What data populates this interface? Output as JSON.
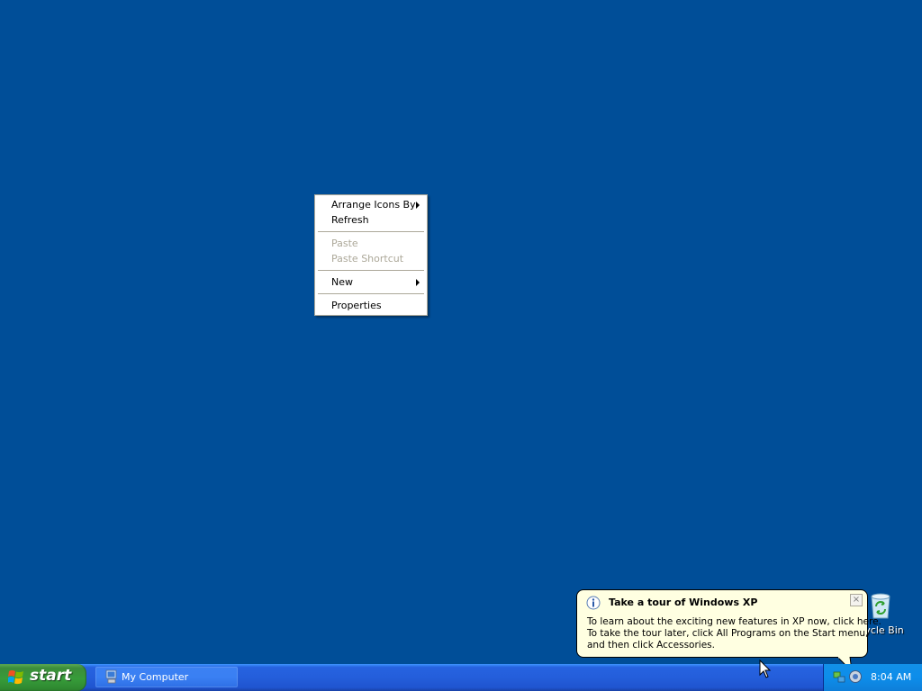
{
  "context_menu": {
    "items": [
      {
        "label": "Arrange Icons By",
        "enabled": true,
        "submenu": true
      },
      {
        "label": "Refresh",
        "enabled": true,
        "submenu": false
      },
      {
        "label": "Paste",
        "enabled": false,
        "submenu": false
      },
      {
        "label": "Paste Shortcut",
        "enabled": false,
        "submenu": false
      },
      {
        "label": "New",
        "enabled": true,
        "submenu": true
      },
      {
        "label": "Properties",
        "enabled": true,
        "submenu": false
      }
    ]
  },
  "desktop": {
    "background_color": "#004E98",
    "icons": [
      {
        "label": "ycle Bin",
        "icon": "recycle-bin-icon"
      }
    ]
  },
  "balloon": {
    "icon": "info-icon",
    "title": "Take a tour of Windows XP",
    "lines": [
      "To learn about the exciting new features in XP now, click here.",
      "To take the tour later, click All Programs on the Start menu,",
      "and then click Accessories."
    ],
    "close_label": "×"
  },
  "taskbar": {
    "start_label": "start",
    "tasks": [
      {
        "label": "My Computer",
        "icon": "my-computer-icon"
      }
    ],
    "tray": {
      "icons": [
        "network-icon",
        "tour-icon"
      ],
      "clock": "8:04 AM"
    }
  }
}
